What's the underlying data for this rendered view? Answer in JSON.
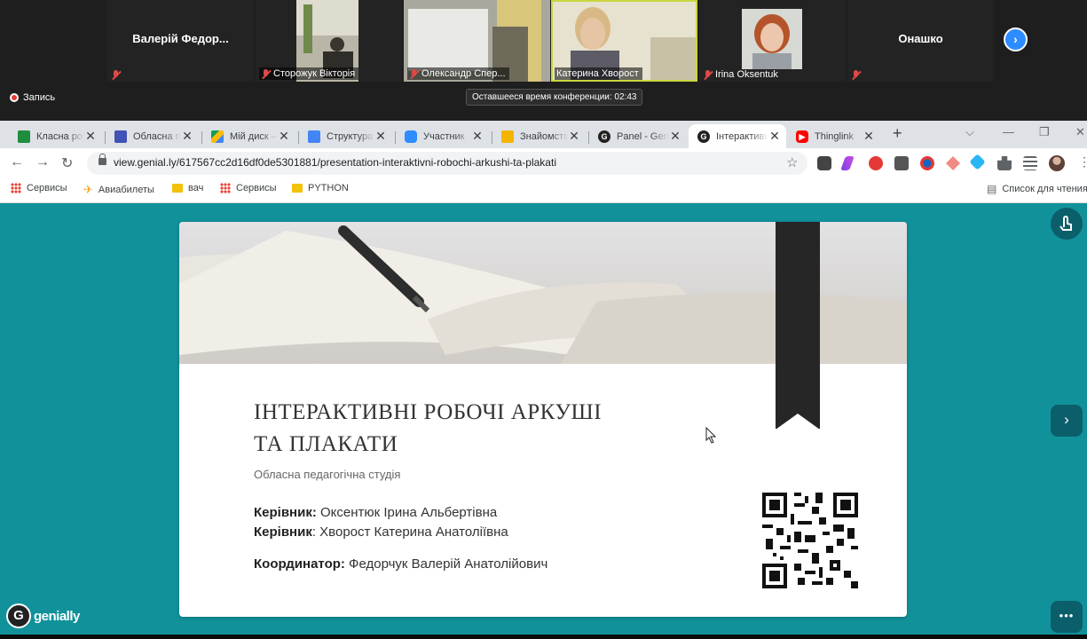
{
  "zoom": {
    "participants": [
      {
        "name": "Валерій  Федор...",
        "video": false,
        "label": ""
      },
      {
        "name": "",
        "video": true,
        "label": "Сторожук Вікторія"
      },
      {
        "name": "",
        "video": true,
        "label": "Олександр Спер..."
      },
      {
        "name": "",
        "video": true,
        "label": "Катерина Хворост"
      },
      {
        "name": "",
        "video": true,
        "label": "Irina Oksentuk"
      },
      {
        "name": "Онашко",
        "video": false,
        "label": ""
      }
    ],
    "recording_label": "Запись",
    "timer_text": "Оставшееся время конференции: 02:43"
  },
  "browser": {
    "tabs": [
      {
        "title": "Класна робота",
        "icon": "classroom-icon",
        "color": "#1e8e3e"
      },
      {
        "title": "Обласна педагогічна",
        "icon": "forms-icon",
        "color": "#3f51b5"
      },
      {
        "title": "Мій диск – Google",
        "icon": "drive-icon",
        "color": "#fbbc04"
      },
      {
        "title": "Структура",
        "icon": "docs-icon",
        "color": "#4285f4"
      },
      {
        "title": "Участник",
        "icon": "zoom-icon",
        "color": "#2d8cff"
      },
      {
        "title": "Знайомство",
        "icon": "slides-icon",
        "color": "#f4b400"
      },
      {
        "title": "Panel - Genially",
        "icon": "genially-icon",
        "color": "#222222"
      },
      {
        "title": "Інтерактивні",
        "icon": "genially-icon",
        "color": "#222222"
      },
      {
        "title": "Thinglink",
        "icon": "youtube-icon",
        "color": "#ff0000"
      }
    ],
    "url": "view.genial.ly/617567cc2d16df0de5301881/presentation-interaktivni-robochi-arkushi-ta-plakati",
    "bookmarks": [
      "Сервисы",
      "Авиабилеты",
      "вач",
      "Сервисы",
      "PYTHON"
    ],
    "reading_list": "Список для чтения"
  },
  "slide": {
    "title_line1": "ІНТЕРАКТИВНІ РОБОЧІ АРКУШІ",
    "title_line2": "ТА ПЛАКАТИ",
    "subtitle": "Обласна педагогічна студія",
    "role1_label": "Керівник:",
    "role1_value": " Оксентюк Ірина Альбертівна",
    "role2_label": "Керівник",
    "role2_value": ": Хворост Катерина Анатоліївна",
    "role3_label": "Координатор:",
    "role3_value": " Федорчук Валерій Анатолійович"
  },
  "genially": {
    "logo_text": "genially",
    "more_label": "•••"
  }
}
